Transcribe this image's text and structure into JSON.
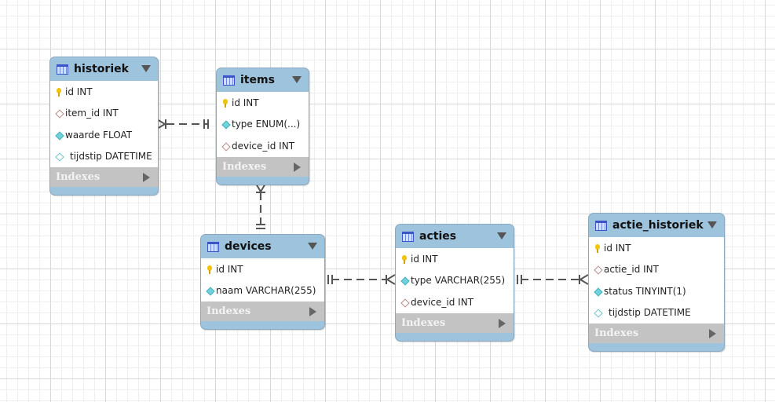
{
  "diagram": {
    "indexes_label": "Indexes",
    "colors": {
      "header": "#9ec3dc",
      "indexes": "#c3c3c3",
      "key": "#f1c40f",
      "not_null": "#6fd3dd",
      "foreign_key": "#b88a86"
    },
    "tables": [
      {
        "name": "historiek",
        "columns": [
          {
            "text": "id INT",
            "icon": "pk"
          },
          {
            "text": "item_id INT",
            "icon": "fk"
          },
          {
            "text": "waarde FLOAT",
            "icon": "nn"
          },
          {
            "text": "tijdstip DATETIME",
            "icon": "col"
          }
        ]
      },
      {
        "name": "items",
        "columns": [
          {
            "text": "id INT",
            "icon": "pk"
          },
          {
            "text": "type ENUM(...)",
            "icon": "nn"
          },
          {
            "text": "device_id INT",
            "icon": "fk"
          }
        ]
      },
      {
        "name": "devices",
        "columns": [
          {
            "text": "id INT",
            "icon": "pk"
          },
          {
            "text": "naam VARCHAR(255)",
            "icon": "nn"
          }
        ]
      },
      {
        "name": "acties",
        "columns": [
          {
            "text": "id INT",
            "icon": "pk"
          },
          {
            "text": "type VARCHAR(255)",
            "icon": "nn"
          },
          {
            "text": "device_id INT",
            "icon": "fk"
          }
        ]
      },
      {
        "name": "actie_historiek",
        "columns": [
          {
            "text": "id INT",
            "icon": "pk"
          },
          {
            "text": "actie_id INT",
            "icon": "fk"
          },
          {
            "text": "status TINYINT(1)",
            "icon": "nn"
          },
          {
            "text": "tijdstip DATETIME",
            "icon": "col"
          }
        ]
      }
    ],
    "relationships": [
      {
        "from": "historiek",
        "to": "items",
        "from_card": "many",
        "to_card": "one"
      },
      {
        "from": "items",
        "to": "devices",
        "from_card": "many",
        "to_card": "one"
      },
      {
        "from": "acties",
        "to": "devices",
        "from_card": "many",
        "to_card": "one"
      },
      {
        "from": "actie_historiek",
        "to": "acties",
        "from_card": "many",
        "to_card": "one"
      }
    ]
  }
}
